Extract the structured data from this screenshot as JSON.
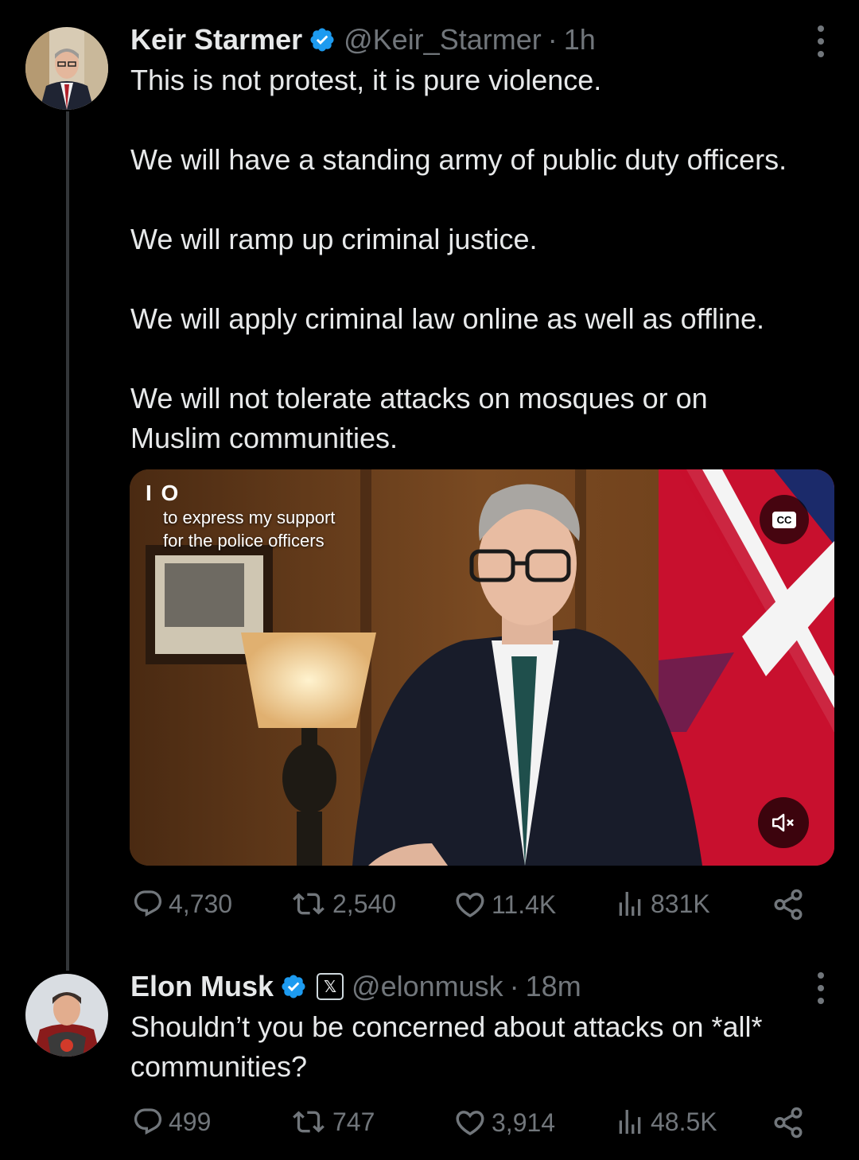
{
  "tweet1": {
    "author_name": "Keir Starmer",
    "handle": "@Keir_Starmer",
    "separator": "·",
    "time": "1h",
    "paragraphs": [
      "This is not protest, it is pure violence.",
      "We will have a standing army of public duty officers.",
      "We will ramp up criminal justice.",
      "We will apply criminal law online as well as offline.",
      "We will not tolerate attacks on mosques or on Muslim communities."
    ],
    "media": {
      "caption_mark": "I O",
      "caption_lines": [
        "to express my support",
        "for the police officers"
      ],
      "cc_label": "CC"
    },
    "stats": {
      "replies": "4,730",
      "reposts": "2,540",
      "likes": "11.4K",
      "views": "831K"
    }
  },
  "tweet2": {
    "author_name": "Elon Musk",
    "x_badge": "𝕏",
    "handle": "@elonmusk",
    "separator": "·",
    "time": "18m",
    "paragraphs": [
      "Shouldn’t you be concerned about attacks on *all* communities?"
    ],
    "stats": {
      "replies": "499",
      "reposts": "747",
      "likes": "3,914",
      "views": "48.5K"
    }
  },
  "colors": {
    "background": "#000000",
    "text_primary": "#e7e9ea",
    "text_secondary": "#71767b",
    "verified": "#1d9bf0",
    "thread_line": "#333639"
  }
}
